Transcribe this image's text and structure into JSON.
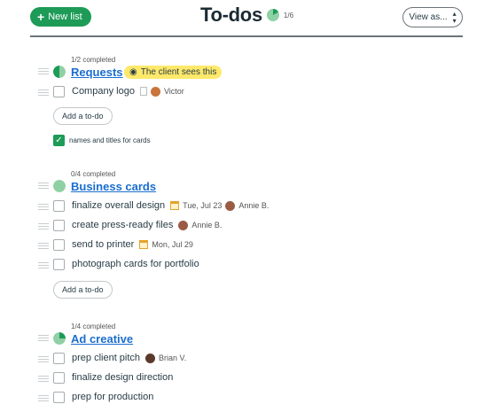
{
  "header": {
    "new_list_label": "New list",
    "title": "To-dos",
    "progress_count": "1/6",
    "view_as_label": "View as..."
  },
  "groups": [
    {
      "completed": "1/2 completed",
      "title": "Requests",
      "progress": 0.5,
      "badge": "The client sees this",
      "items": [
        {
          "text": "Company logo",
          "assignee": "Victor",
          "done": false
        },
        {
          "text": "names and titles for cards",
          "done": true
        }
      ],
      "add_label": "Add a to-do"
    },
    {
      "completed": "0/4 completed",
      "title": "Business cards",
      "progress": 0,
      "items": [
        {
          "text": "finalize overall design",
          "due": "Tue, Jul 23",
          "assignee": "Annie B.",
          "done": false
        },
        {
          "text": "create press-ready files",
          "assignee": "Annie B.",
          "done": false
        },
        {
          "text": "send to printer",
          "due": "Mon, Jul 29",
          "done": false
        },
        {
          "text": "photograph cards for portfolio",
          "done": false
        }
      ],
      "add_label": "Add a to-do"
    },
    {
      "completed": "1/4 completed",
      "title": "Ad creative",
      "progress": 0.25,
      "items": [
        {
          "text": "prep client pitch",
          "assignee": "Brian V.",
          "done": false
        },
        {
          "text": "finalize design direction",
          "done": false
        },
        {
          "text": "prep for production",
          "done": false
        }
      ]
    }
  ],
  "colors": {
    "accent_green": "#1d9b57",
    "link_blue": "#1a6ecf",
    "badge_yellow": "#ffe96b",
    "pie_light_green": "#8fd1a4"
  }
}
